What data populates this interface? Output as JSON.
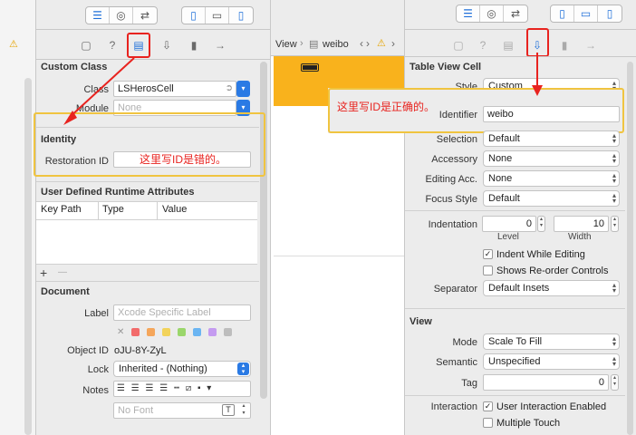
{
  "left": {
    "class_section": "Custom Class",
    "class_label": "Class",
    "class_value": "LSHerosCell",
    "module_label": "Module",
    "module_value": "None",
    "identity_section": "Identity",
    "restoration_label": "Restoration ID",
    "restoration_note": "这里写ID是错的。",
    "udra_section": "User Defined Runtime Attributes",
    "udra_cols": [
      "Key Path",
      "Type",
      "Value"
    ],
    "udra_add": "+",
    "udra_remove": "—",
    "document_section": "Document",
    "label_label": "Label",
    "label_placeholder": "Xcode Specific Label",
    "objectid_label": "Object ID",
    "objectid_value": "oJU-8Y-ZyL",
    "lock_label": "Lock",
    "lock_value": "Inherited - (Nothing)",
    "notes_label": "Notes",
    "font_placeholder": "No Font",
    "swatch_colors": [
      "#f26b6b",
      "#f5a65b",
      "#f2d35b",
      "#9ad66b",
      "#6bb5f2",
      "#c49bf0",
      "#bdbdbd"
    ]
  },
  "middle": {
    "breadcrumb_view": "View",
    "breadcrumb_item": "weibo",
    "accent": "#f9b21c"
  },
  "right": {
    "tvc_section": "Table View Cell",
    "style_label": "Style",
    "style_value": "Custom",
    "identifier_label": "Identifier",
    "identifier_value": "weibo",
    "identifier_note": "这里写ID是正确的。",
    "selection_label": "Selection",
    "selection_value": "Default",
    "accessory_label": "Accessory",
    "accessory_value": "None",
    "editing_label": "Editing Acc.",
    "editing_value": "None",
    "focus_label": "Focus Style",
    "focus_value": "Default",
    "indentation_label": "Indentation",
    "level_value": "0",
    "width_value": "10",
    "level_caption": "Level",
    "width_caption": "Width",
    "indent_editing": "Indent While Editing",
    "show_reorder": "Shows Re-order Controls",
    "separator_label": "Separator",
    "separator_value": "Default Insets",
    "view_section": "View",
    "mode_label": "Mode",
    "mode_value": "Scale To Fill",
    "semantic_label": "Semantic",
    "semantic_value": "Unspecified",
    "tag_label": "Tag",
    "tag_value": "0",
    "interaction_label": "Interaction",
    "user_interaction": "User Interaction Enabled",
    "multiple_touch": "Multiple Touch"
  }
}
